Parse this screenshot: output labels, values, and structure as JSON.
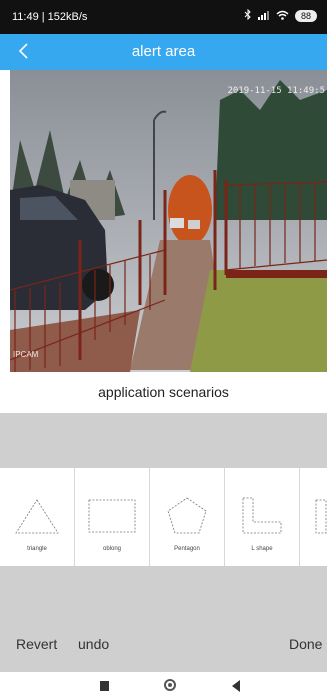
{
  "status_bar": {
    "time_speed": "11:49 | 152kB/s",
    "battery": "88",
    "icons": [
      "alarm-icon",
      "bluetooth-icon",
      "signal-icon",
      "wifi-icon",
      "battery-icon"
    ]
  },
  "header": {
    "title": "alert area",
    "back_icon": "back-chevron-icon",
    "color": "#35a8ef"
  },
  "video": {
    "timestamp": "2019-11-15 11:49:5",
    "camera_label": "IPCAM"
  },
  "section": {
    "label": "application scenarios"
  },
  "shapes": [
    {
      "label": "triangle",
      "icon": "triangle-icon"
    },
    {
      "label": "oblong",
      "icon": "oblong-icon"
    },
    {
      "label": "Pentagon",
      "icon": "pentagon-icon"
    },
    {
      "label": "L shape",
      "icon": "l-shape-icon"
    },
    {
      "label": "",
      "icon": "partial-shape-icon"
    }
  ],
  "actions": {
    "revert": "Revert",
    "undo": "undo",
    "done": "Done"
  }
}
